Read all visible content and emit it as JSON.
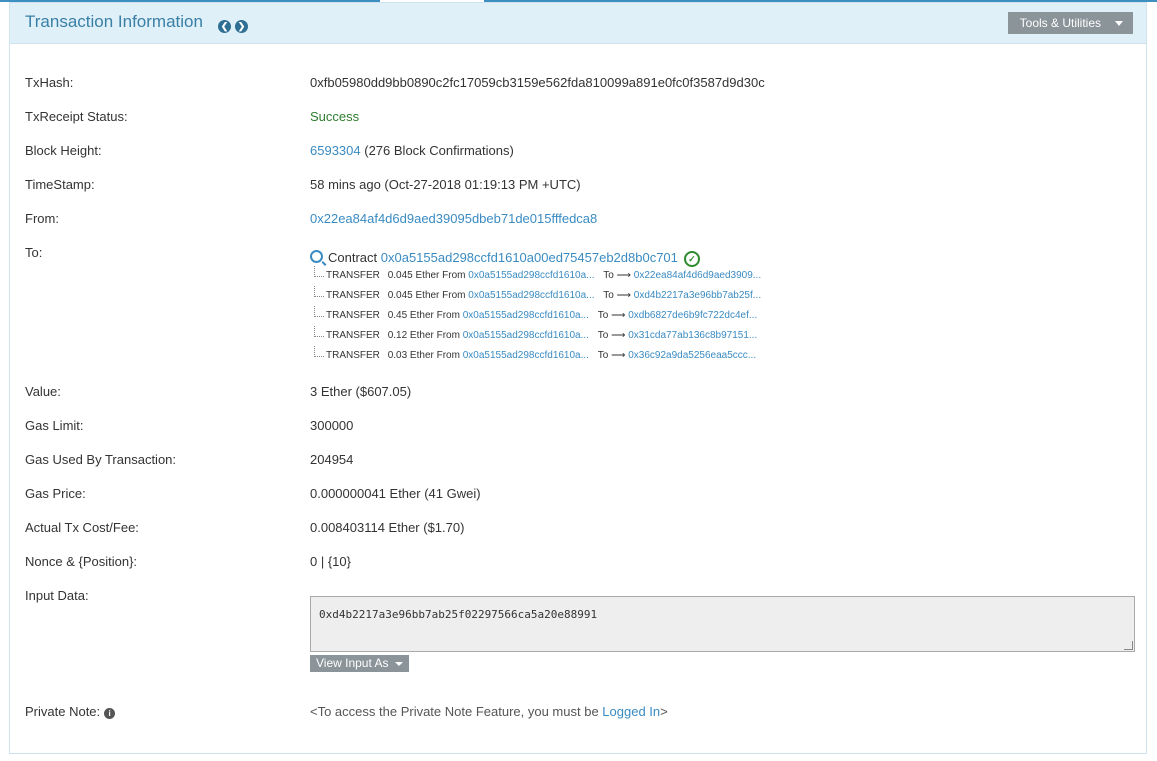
{
  "header": {
    "title": "Transaction Information",
    "prev_icon": "chevron-left-circle-icon",
    "next_icon": "chevron-right-circle-icon",
    "tools_label": "Tools & Utilities"
  },
  "fields": {
    "txhash": {
      "label": "TxHash:",
      "value": "0xfb05980dd9bb0890c2fc17059cb3159e562fda810099a891e0fc0f3587d9d30c"
    },
    "status": {
      "label": "TxReceipt Status:",
      "value": "Success"
    },
    "block": {
      "label": "Block Height:",
      "value": "6593304",
      "confirmations": "(276 Block Confirmations)"
    },
    "timestamp": {
      "label": "TimeStamp:",
      "value": "58 mins ago (Oct-27-2018 01:19:13 PM +UTC)"
    },
    "from": {
      "label": "From:",
      "value": "0x22ea84af4d6d9aed39095dbeb71de015fffedca8"
    },
    "to": {
      "label": "To:",
      "contract_label": "Contract",
      "contract_address": "0x0a5155ad298ccfd1610a00ed75457eb2d8b0c701",
      "transfers": [
        {
          "type": "TRANSFER",
          "amount": "0.045 Ether From",
          "from": "0x0a5155ad298ccfd1610a...",
          "to_label": "To",
          "to": "0x22ea84af4d6d9aed3909..."
        },
        {
          "type": "TRANSFER",
          "amount": "0.045 Ether From",
          "from": "0x0a5155ad298ccfd1610a...",
          "to_label": "To",
          "to": "0xd4b2217a3e96bb7ab25f..."
        },
        {
          "type": "TRANSFER",
          "amount": "0.45 Ether From",
          "from": "0x0a5155ad298ccfd1610a...",
          "to_label": "To",
          "to": "0xdb6827de6b9fc722dc4ef..."
        },
        {
          "type": "TRANSFER",
          "amount": "0.12 Ether From",
          "from": "0x0a5155ad298ccfd1610a...",
          "to_label": "To",
          "to": "0x31cda77ab136c8b97151..."
        },
        {
          "type": "TRANSFER",
          "amount": "0.03 Ether From",
          "from": "0x0a5155ad298ccfd1610a...",
          "to_label": "To",
          "to": "0x36c92a9da5256eaa5ccc..."
        }
      ]
    },
    "value": {
      "label": "Value:",
      "value": "3 Ether ($607.05)"
    },
    "gas_limit": {
      "label": "Gas Limit:",
      "value": "300000"
    },
    "gas_used": {
      "label": "Gas Used By Transaction:",
      "value": "204954"
    },
    "gas_price": {
      "label": "Gas Price:",
      "value": "0.000000041 Ether (41 Gwei)"
    },
    "tx_cost": {
      "label": "Actual Tx Cost/Fee:",
      "value": "0.008403114 Ether ($1.70)"
    },
    "nonce": {
      "label": "Nonce & {Position}:",
      "value": "0 | {10}"
    },
    "input": {
      "label": "Input Data:",
      "value": "0xd4b2217a3e96bb7ab25f02297566ca5a20e88991",
      "view_as_label": "View Input As"
    },
    "note": {
      "label": "Private Note:",
      "prefix": "<To access the Private Note Feature, you must be ",
      "link": "Logged In",
      "suffix": ">"
    }
  },
  "colors": {
    "accent": "#3a8bc2",
    "success": "#2e7d2e",
    "header_bg": "#dff0f8"
  }
}
